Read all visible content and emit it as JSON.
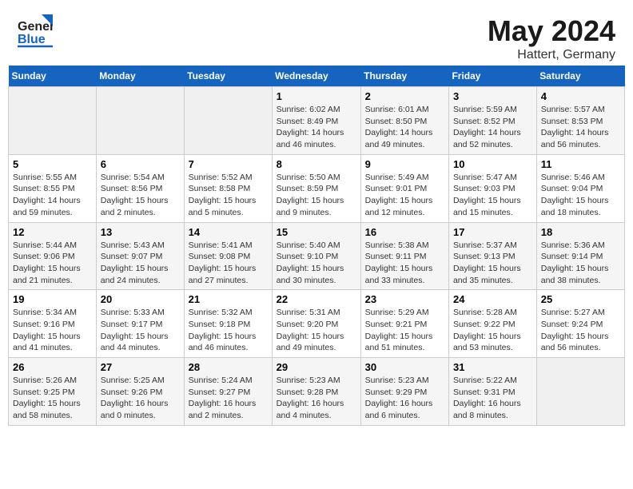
{
  "header": {
    "logo_general": "General",
    "logo_blue": "Blue",
    "title": "May 2024",
    "subtitle": "Hattert, Germany"
  },
  "weekdays": [
    "Sunday",
    "Monday",
    "Tuesday",
    "Wednesday",
    "Thursday",
    "Friday",
    "Saturday"
  ],
  "weeks": [
    [
      {
        "day": "",
        "info": ""
      },
      {
        "day": "",
        "info": ""
      },
      {
        "day": "",
        "info": ""
      },
      {
        "day": "1",
        "info": "Sunrise: 6:02 AM\nSunset: 8:49 PM\nDaylight: 14 hours\nand 46 minutes."
      },
      {
        "day": "2",
        "info": "Sunrise: 6:01 AM\nSunset: 8:50 PM\nDaylight: 14 hours\nand 49 minutes."
      },
      {
        "day": "3",
        "info": "Sunrise: 5:59 AM\nSunset: 8:52 PM\nDaylight: 14 hours\nand 52 minutes."
      },
      {
        "day": "4",
        "info": "Sunrise: 5:57 AM\nSunset: 8:53 PM\nDaylight: 14 hours\nand 56 minutes."
      }
    ],
    [
      {
        "day": "5",
        "info": "Sunrise: 5:55 AM\nSunset: 8:55 PM\nDaylight: 14 hours\nand 59 minutes."
      },
      {
        "day": "6",
        "info": "Sunrise: 5:54 AM\nSunset: 8:56 PM\nDaylight: 15 hours\nand 2 minutes."
      },
      {
        "day": "7",
        "info": "Sunrise: 5:52 AM\nSunset: 8:58 PM\nDaylight: 15 hours\nand 5 minutes."
      },
      {
        "day": "8",
        "info": "Sunrise: 5:50 AM\nSunset: 8:59 PM\nDaylight: 15 hours\nand 9 minutes."
      },
      {
        "day": "9",
        "info": "Sunrise: 5:49 AM\nSunset: 9:01 PM\nDaylight: 15 hours\nand 12 minutes."
      },
      {
        "day": "10",
        "info": "Sunrise: 5:47 AM\nSunset: 9:03 PM\nDaylight: 15 hours\nand 15 minutes."
      },
      {
        "day": "11",
        "info": "Sunrise: 5:46 AM\nSunset: 9:04 PM\nDaylight: 15 hours\nand 18 minutes."
      }
    ],
    [
      {
        "day": "12",
        "info": "Sunrise: 5:44 AM\nSunset: 9:06 PM\nDaylight: 15 hours\nand 21 minutes."
      },
      {
        "day": "13",
        "info": "Sunrise: 5:43 AM\nSunset: 9:07 PM\nDaylight: 15 hours\nand 24 minutes."
      },
      {
        "day": "14",
        "info": "Sunrise: 5:41 AM\nSunset: 9:08 PM\nDaylight: 15 hours\nand 27 minutes."
      },
      {
        "day": "15",
        "info": "Sunrise: 5:40 AM\nSunset: 9:10 PM\nDaylight: 15 hours\nand 30 minutes."
      },
      {
        "day": "16",
        "info": "Sunrise: 5:38 AM\nSunset: 9:11 PM\nDaylight: 15 hours\nand 33 minutes."
      },
      {
        "day": "17",
        "info": "Sunrise: 5:37 AM\nSunset: 9:13 PM\nDaylight: 15 hours\nand 35 minutes."
      },
      {
        "day": "18",
        "info": "Sunrise: 5:36 AM\nSunset: 9:14 PM\nDaylight: 15 hours\nand 38 minutes."
      }
    ],
    [
      {
        "day": "19",
        "info": "Sunrise: 5:34 AM\nSunset: 9:16 PM\nDaylight: 15 hours\nand 41 minutes."
      },
      {
        "day": "20",
        "info": "Sunrise: 5:33 AM\nSunset: 9:17 PM\nDaylight: 15 hours\nand 44 minutes."
      },
      {
        "day": "21",
        "info": "Sunrise: 5:32 AM\nSunset: 9:18 PM\nDaylight: 15 hours\nand 46 minutes."
      },
      {
        "day": "22",
        "info": "Sunrise: 5:31 AM\nSunset: 9:20 PM\nDaylight: 15 hours\nand 49 minutes."
      },
      {
        "day": "23",
        "info": "Sunrise: 5:29 AM\nSunset: 9:21 PM\nDaylight: 15 hours\nand 51 minutes."
      },
      {
        "day": "24",
        "info": "Sunrise: 5:28 AM\nSunset: 9:22 PM\nDaylight: 15 hours\nand 53 minutes."
      },
      {
        "day": "25",
        "info": "Sunrise: 5:27 AM\nSunset: 9:24 PM\nDaylight: 15 hours\nand 56 minutes."
      }
    ],
    [
      {
        "day": "26",
        "info": "Sunrise: 5:26 AM\nSunset: 9:25 PM\nDaylight: 15 hours\nand 58 minutes."
      },
      {
        "day": "27",
        "info": "Sunrise: 5:25 AM\nSunset: 9:26 PM\nDaylight: 16 hours\nand 0 minutes."
      },
      {
        "day": "28",
        "info": "Sunrise: 5:24 AM\nSunset: 9:27 PM\nDaylight: 16 hours\nand 2 minutes."
      },
      {
        "day": "29",
        "info": "Sunrise: 5:23 AM\nSunset: 9:28 PM\nDaylight: 16 hours\nand 4 minutes."
      },
      {
        "day": "30",
        "info": "Sunrise: 5:23 AM\nSunset: 9:29 PM\nDaylight: 16 hours\nand 6 minutes."
      },
      {
        "day": "31",
        "info": "Sunrise: 5:22 AM\nSunset: 9:31 PM\nDaylight: 16 hours\nand 8 minutes."
      },
      {
        "day": "",
        "info": ""
      }
    ]
  ]
}
